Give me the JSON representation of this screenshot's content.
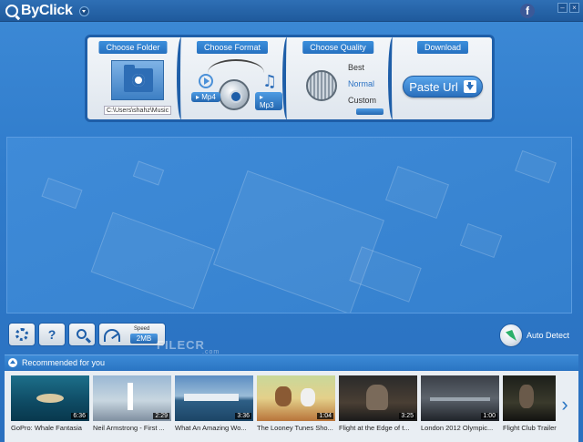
{
  "app": {
    "brand": "ByClick",
    "social_icon": "f"
  },
  "panel": {
    "folder": {
      "title": "Choose Folder",
      "path": "C:\\Users\\shahz\\Music"
    },
    "format": {
      "title": "Choose Format",
      "video_option": "Mp4",
      "audio_option": "Mp3"
    },
    "quality": {
      "title": "Choose Quality",
      "options": [
        "Best",
        "Normal",
        "Custom"
      ],
      "selected": "Normal"
    },
    "download": {
      "title": "Download",
      "paste_label": "Paste Url"
    }
  },
  "toolbar": {
    "help_label": "?",
    "speed_label": "Speed",
    "speed_value": "2MB",
    "auto_detect_label": "Auto Detect"
  },
  "watermark": {
    "text": "FILECR",
    "sub": ".com"
  },
  "recommended": {
    "title": "Recommended for you",
    "videos": [
      {
        "title": "GoPro: Whale Fantasia",
        "duration": "6:36"
      },
      {
        "title": "Neil Armstrong - First ...",
        "duration": "2:29"
      },
      {
        "title": "What An Amazing Wo...",
        "duration": "3:36"
      },
      {
        "title": "The Looney Tunes Sho...",
        "duration": "1:04"
      },
      {
        "title": "Flight at the Edge of t...",
        "duration": "3:25"
      },
      {
        "title": "London 2012 Olympic...",
        "duration": "1:00"
      },
      {
        "title": "Flight Club Trailer",
        "duration": ""
      }
    ]
  },
  "colors": {
    "accent": "#2b76c4",
    "panel_border": "#1e5ea8"
  }
}
